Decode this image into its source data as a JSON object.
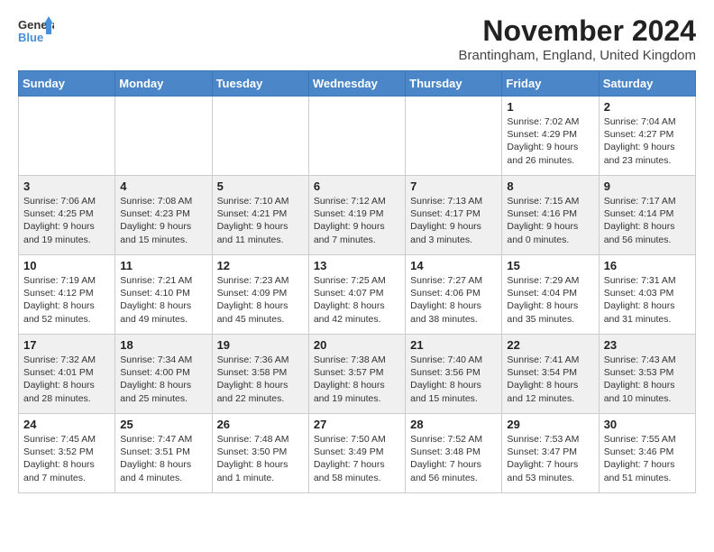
{
  "logo": {
    "line1": "General",
    "line2": "Blue"
  },
  "title": "November 2024",
  "location": "Brantingham, England, United Kingdom",
  "days_of_week": [
    "Sunday",
    "Monday",
    "Tuesday",
    "Wednesday",
    "Thursday",
    "Friday",
    "Saturday"
  ],
  "weeks": [
    [
      {
        "day": "",
        "info": ""
      },
      {
        "day": "",
        "info": ""
      },
      {
        "day": "",
        "info": ""
      },
      {
        "day": "",
        "info": ""
      },
      {
        "day": "",
        "info": ""
      },
      {
        "day": "1",
        "info": "Sunrise: 7:02 AM\nSunset: 4:29 PM\nDaylight: 9 hours and 26 minutes."
      },
      {
        "day": "2",
        "info": "Sunrise: 7:04 AM\nSunset: 4:27 PM\nDaylight: 9 hours and 23 minutes."
      }
    ],
    [
      {
        "day": "3",
        "info": "Sunrise: 7:06 AM\nSunset: 4:25 PM\nDaylight: 9 hours and 19 minutes."
      },
      {
        "day": "4",
        "info": "Sunrise: 7:08 AM\nSunset: 4:23 PM\nDaylight: 9 hours and 15 minutes."
      },
      {
        "day": "5",
        "info": "Sunrise: 7:10 AM\nSunset: 4:21 PM\nDaylight: 9 hours and 11 minutes."
      },
      {
        "day": "6",
        "info": "Sunrise: 7:12 AM\nSunset: 4:19 PM\nDaylight: 9 hours and 7 minutes."
      },
      {
        "day": "7",
        "info": "Sunrise: 7:13 AM\nSunset: 4:17 PM\nDaylight: 9 hours and 3 minutes."
      },
      {
        "day": "8",
        "info": "Sunrise: 7:15 AM\nSunset: 4:16 PM\nDaylight: 9 hours and 0 minutes."
      },
      {
        "day": "9",
        "info": "Sunrise: 7:17 AM\nSunset: 4:14 PM\nDaylight: 8 hours and 56 minutes."
      }
    ],
    [
      {
        "day": "10",
        "info": "Sunrise: 7:19 AM\nSunset: 4:12 PM\nDaylight: 8 hours and 52 minutes."
      },
      {
        "day": "11",
        "info": "Sunrise: 7:21 AM\nSunset: 4:10 PM\nDaylight: 8 hours and 49 minutes."
      },
      {
        "day": "12",
        "info": "Sunrise: 7:23 AM\nSunset: 4:09 PM\nDaylight: 8 hours and 45 minutes."
      },
      {
        "day": "13",
        "info": "Sunrise: 7:25 AM\nSunset: 4:07 PM\nDaylight: 8 hours and 42 minutes."
      },
      {
        "day": "14",
        "info": "Sunrise: 7:27 AM\nSunset: 4:06 PM\nDaylight: 8 hours and 38 minutes."
      },
      {
        "day": "15",
        "info": "Sunrise: 7:29 AM\nSunset: 4:04 PM\nDaylight: 8 hours and 35 minutes."
      },
      {
        "day": "16",
        "info": "Sunrise: 7:31 AM\nSunset: 4:03 PM\nDaylight: 8 hours and 31 minutes."
      }
    ],
    [
      {
        "day": "17",
        "info": "Sunrise: 7:32 AM\nSunset: 4:01 PM\nDaylight: 8 hours and 28 minutes."
      },
      {
        "day": "18",
        "info": "Sunrise: 7:34 AM\nSunset: 4:00 PM\nDaylight: 8 hours and 25 minutes."
      },
      {
        "day": "19",
        "info": "Sunrise: 7:36 AM\nSunset: 3:58 PM\nDaylight: 8 hours and 22 minutes."
      },
      {
        "day": "20",
        "info": "Sunrise: 7:38 AM\nSunset: 3:57 PM\nDaylight: 8 hours and 19 minutes."
      },
      {
        "day": "21",
        "info": "Sunrise: 7:40 AM\nSunset: 3:56 PM\nDaylight: 8 hours and 15 minutes."
      },
      {
        "day": "22",
        "info": "Sunrise: 7:41 AM\nSunset: 3:54 PM\nDaylight: 8 hours and 12 minutes."
      },
      {
        "day": "23",
        "info": "Sunrise: 7:43 AM\nSunset: 3:53 PM\nDaylight: 8 hours and 10 minutes."
      }
    ],
    [
      {
        "day": "24",
        "info": "Sunrise: 7:45 AM\nSunset: 3:52 PM\nDaylight: 8 hours and 7 minutes."
      },
      {
        "day": "25",
        "info": "Sunrise: 7:47 AM\nSunset: 3:51 PM\nDaylight: 8 hours and 4 minutes."
      },
      {
        "day": "26",
        "info": "Sunrise: 7:48 AM\nSunset: 3:50 PM\nDaylight: 8 hours and 1 minute."
      },
      {
        "day": "27",
        "info": "Sunrise: 7:50 AM\nSunset: 3:49 PM\nDaylight: 7 hours and 58 minutes."
      },
      {
        "day": "28",
        "info": "Sunrise: 7:52 AM\nSunset: 3:48 PM\nDaylight: 7 hours and 56 minutes."
      },
      {
        "day": "29",
        "info": "Sunrise: 7:53 AM\nSunset: 3:47 PM\nDaylight: 7 hours and 53 minutes."
      },
      {
        "day": "30",
        "info": "Sunrise: 7:55 AM\nSunset: 3:46 PM\nDaylight: 7 hours and 51 minutes."
      }
    ]
  ]
}
